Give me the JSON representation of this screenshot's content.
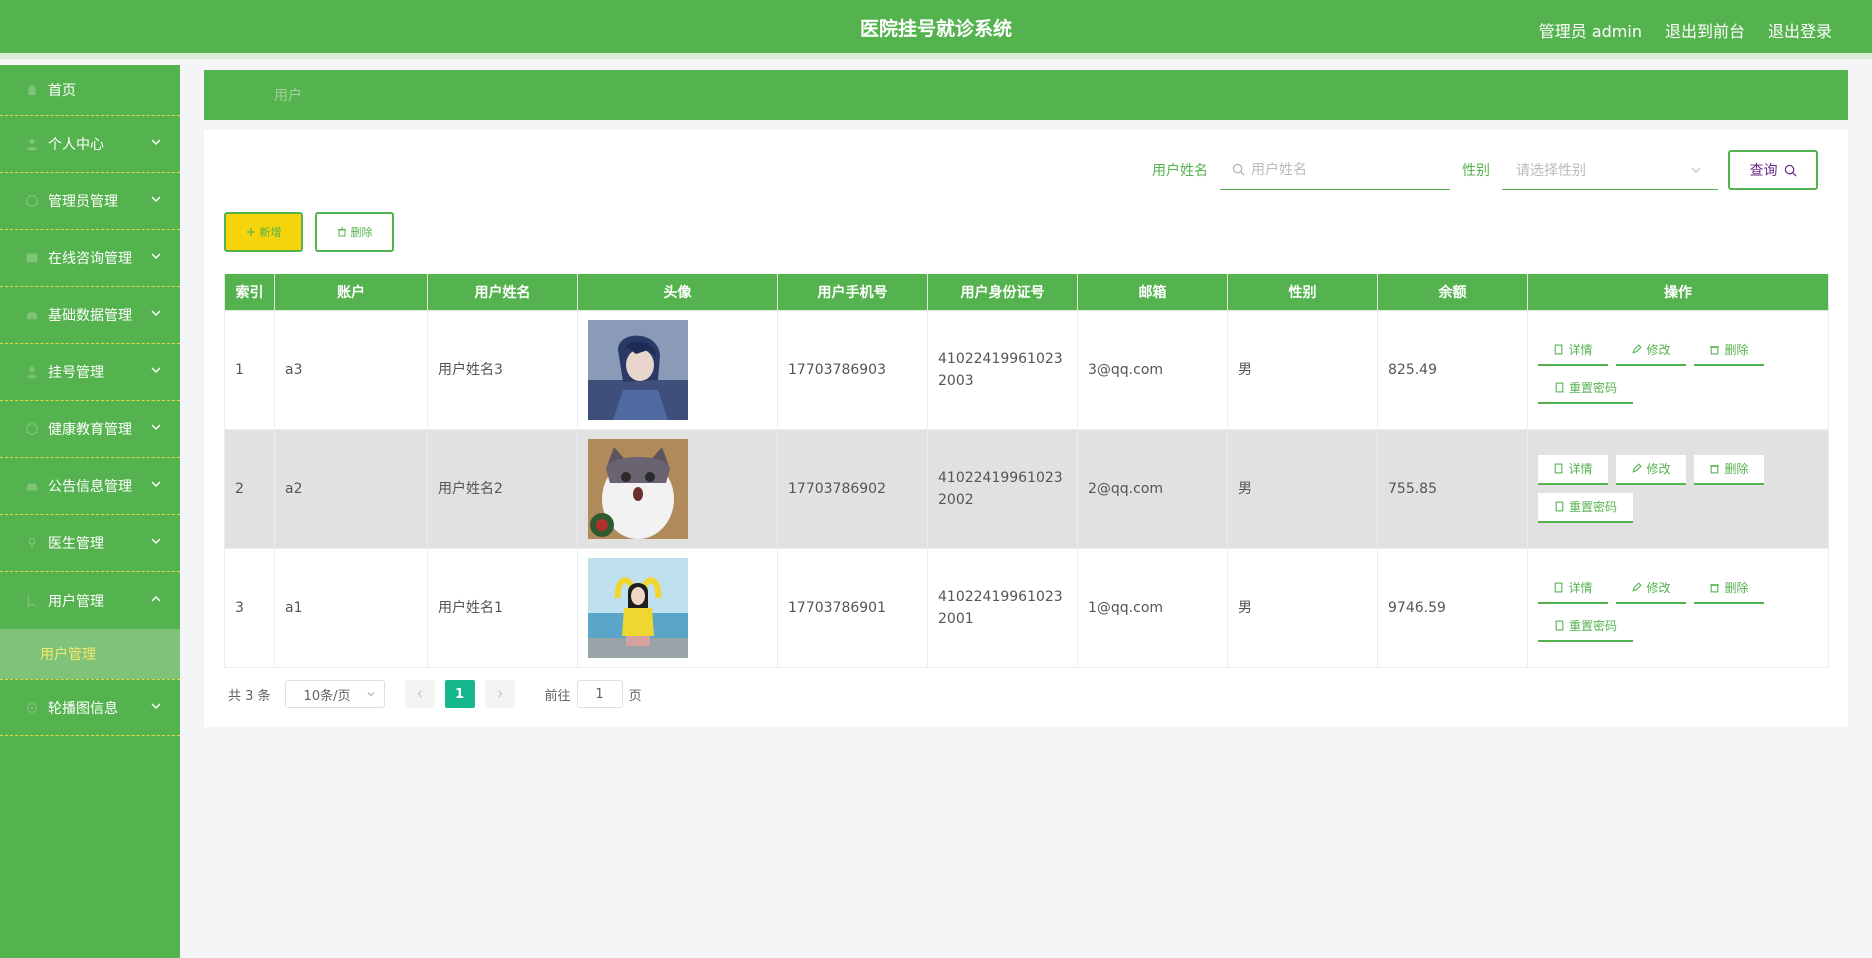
{
  "header": {
    "title": "医院挂号就诊系统",
    "user": "管理员 admin",
    "to_front": "退出到前台",
    "logout": "退出登录"
  },
  "sidebar": {
    "items": [
      {
        "label": "首页",
        "icon": "home-icon"
      },
      {
        "label": "个人中心",
        "icon": "user-icon"
      },
      {
        "label": "管理员管理",
        "icon": "circle-icon"
      },
      {
        "label": "在线咨询管理",
        "icon": "grid-icon"
      },
      {
        "label": "基础数据管理",
        "icon": "car-icon"
      },
      {
        "label": "挂号管理",
        "icon": "person-icon"
      },
      {
        "label": "健康教育管理",
        "icon": "circle-icon"
      },
      {
        "label": "公告信息管理",
        "icon": "car-icon"
      },
      {
        "label": "医生管理",
        "icon": "pin-icon"
      },
      {
        "label": "用户管理",
        "icon": "bookmark-icon"
      },
      {
        "label": "轮播图信息",
        "icon": "gear-icon"
      }
    ],
    "submenu_active": "用户管理"
  },
  "breadcrumb": {
    "current": "用户"
  },
  "search": {
    "name_label": "用户姓名",
    "name_placeholder": "用户姓名",
    "gender_label": "性别",
    "gender_placeholder": "请选择性别",
    "query_label": "查询"
  },
  "actions": {
    "add_label": "新增",
    "delete_label": "删除"
  },
  "table": {
    "columns": [
      "索引",
      "账户",
      "用户姓名",
      "头像",
      "用户手机号",
      "用户身份证号",
      "邮箱",
      "性别",
      "余额",
      "操作"
    ],
    "rows": [
      {
        "index": "1",
        "account": "a3",
        "name": "用户姓名3",
        "phone": "17703786903",
        "id_card": "410224199610232003",
        "email": "3@qq.com",
        "gender": "男",
        "balance": "825.49",
        "avatar": "anime-boy"
      },
      {
        "index": "2",
        "account": "a2",
        "name": "用户姓名2",
        "phone": "17703786902",
        "id_card": "410224199610232002",
        "email": "2@qq.com",
        "gender": "男",
        "balance": "755.85",
        "avatar": "cat"
      },
      {
        "index": "3",
        "account": "a1",
        "name": "用户姓名1",
        "phone": "17703786901",
        "id_card": "410224199610232001",
        "email": "1@qq.com",
        "gender": "男",
        "balance": "9746.59",
        "avatar": "girl-beach"
      }
    ],
    "row_actions": {
      "detail": "详情",
      "edit": "修改",
      "delete": "删除",
      "reset": "重置密码"
    }
  },
  "pagination": {
    "total": "共 3 条",
    "page_size": "10条/页",
    "current_page": "1",
    "goto_label": "前往",
    "goto_value": "1",
    "page_suffix": "页"
  },
  "colors": {
    "primary": "#55b34f",
    "accent_yellow": "#f5d40c",
    "pager_active": "#14b88c"
  }
}
